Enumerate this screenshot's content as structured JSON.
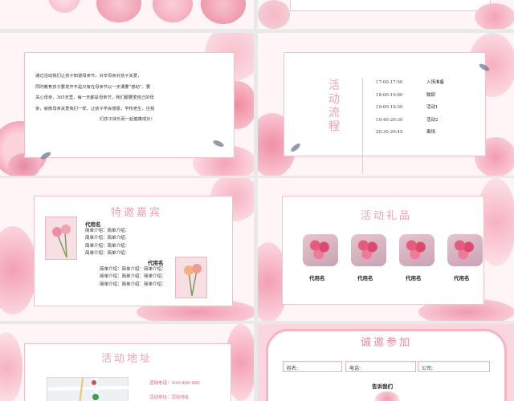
{
  "colors": {
    "accent": "#f2a0b3",
    "petal": "#f7b5c3",
    "deep_petal": "#e87b95",
    "leaf": "#6b7a8f"
  },
  "slide3": {
    "paragraph_lines": [
      "通过活动我们让孩子知道母亲节，对辛母亲对孩子关爱，",
      "同时教育孩子要发开不是只有在母亲节以一天课要“感动”，要",
      "关心母亲，365天里，每一天都是母亲节，我们都要爱自己的母",
      "亲，就像母亲关爱我们一样，让孩子学会感恩，学校老生，往我",
      "们孩子快乐而一起健康成长！"
    ]
  },
  "slide4": {
    "title": "活动流程",
    "schedule": [
      {
        "time": "17:00-17:50",
        "item": "入场准备"
      },
      {
        "time": "18:00-19:00",
        "item": "致辞"
      },
      {
        "time": "19:00-19:30",
        "item": "活动1"
      },
      {
        "time": "19:40-20:30",
        "item": "活动2"
      },
      {
        "time": "20:30-20:45",
        "item": "离场"
      }
    ]
  },
  "slide5": {
    "title": "特邀嘉宾",
    "guest1": {
      "name": "代用名",
      "lines": [
        "简单介绍：简单介绍：",
        "简单介绍：简单介绍：",
        "简单介绍：简单介绍：",
        "简单介绍：简单介绍："
      ]
    },
    "guest2": {
      "name": "代用名",
      "lines": [
        "简单介绍：简单介绍：简单介绍：",
        "简单介绍：简单介绍：简单介绍：",
        "简单介绍：简单介绍：简单介绍："
      ]
    }
  },
  "slide6": {
    "title": "活动礼品",
    "gifts": [
      "代用名",
      "代用名",
      "代用名",
      "代用名"
    ]
  },
  "slide7": {
    "title": "活动地址",
    "phone": "咨询电话：400-888-888",
    "address": "活动地址：活动地址"
  },
  "slide8": {
    "title": "诚邀参加",
    "fields": [
      "姓名:",
      "电话:",
      "公司:"
    ],
    "share": "告诉我们"
  }
}
